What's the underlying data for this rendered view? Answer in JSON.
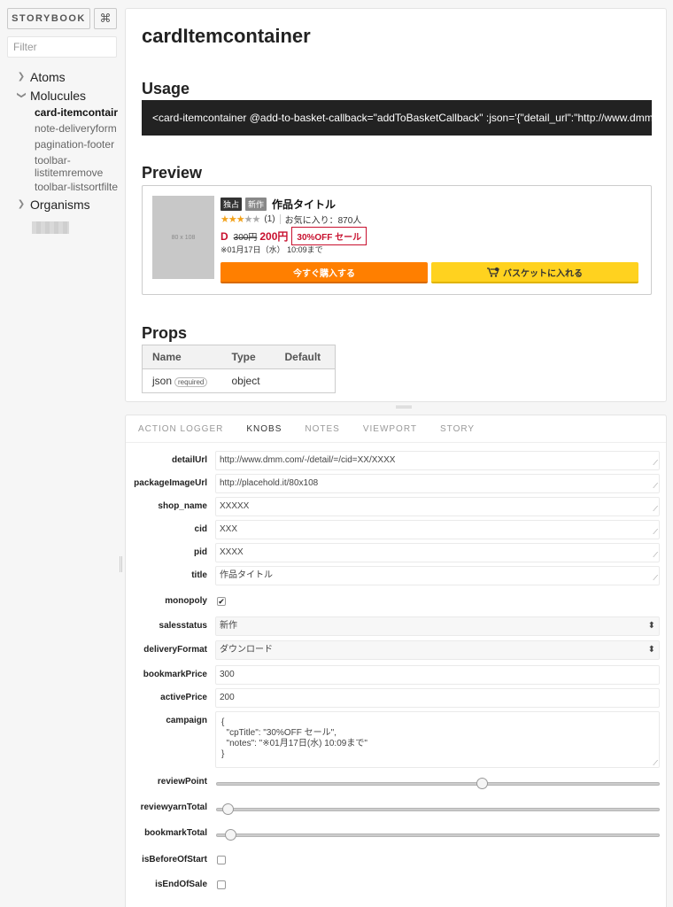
{
  "sidebar": {
    "brand": "STORYBOOK",
    "shortcut_glyph": "⌘",
    "filter_placeholder": "Filter",
    "tree": [
      {
        "label": "Atoms",
        "expanded": false
      },
      {
        "label": "Molucules",
        "expanded": true,
        "children": [
          "card-itemcontainer",
          "note-deliveryformat",
          "pagination-footer",
          "toolbar-listitemremove",
          "toolbar-listsortfilter"
        ]
      },
      {
        "label": "Organisms",
        "expanded": false
      }
    ],
    "selected": "card-itemcontainer",
    "tree_children_display": [
      "card-itemcontair",
      "note-deliveryform",
      "pagination-footer",
      "toolbar-\nlistitemremove",
      "toolbar-listsortfilte"
    ]
  },
  "preview": {
    "title": "cardItemcontainer",
    "usage_heading": "Usage",
    "usage_code": "<card-itemcontainer @add-to-basket-callback=\"addToBasketCallback\" :json='{\"detail_url\":\"http://www.dmm.com",
    "preview_heading": "Preview",
    "props_heading": "Props",
    "card": {
      "thumb_text": "80 x 108",
      "badge_monopoly": "独占",
      "badge_status": "新作",
      "title": "作品タイトル",
      "review_count": "(1)",
      "bookmark_text": "お気に入り：870人",
      "currency_glyph": "D",
      "old_price": "300円",
      "new_price": "200円",
      "campaign": "30%OFF セール",
      "notes": "※01月17日（水） 10:09まで",
      "buy_label": "今すぐ購入する",
      "basket_label": "バスケットに入れる",
      "stars_filled": 3,
      "stars_total": 5
    },
    "props_table": {
      "headers": [
        "Name",
        "Type",
        "Default"
      ],
      "rows": [
        {
          "name": "json",
          "required": "required",
          "type": "object",
          "default": ""
        }
      ]
    }
  },
  "addons": {
    "tabs": [
      "ACTION LOGGER",
      "KNOBS",
      "NOTES",
      "VIEWPORT",
      "STORY"
    ],
    "active_tab": "KNOBS",
    "knobs": {
      "detailUrl": {
        "label": "detailUrl",
        "value": "http://www.dmm.com/-/detail/=/cid=XX/XXXX"
      },
      "packageImageUrl": {
        "label": "packageImageUrl",
        "value": "http://placehold.it/80x108"
      },
      "shop_name": {
        "label": "shop_name",
        "value": "XXXXX"
      },
      "cid": {
        "label": "cid",
        "value": "XXX"
      },
      "pid": {
        "label": "pid",
        "value": "XXXX"
      },
      "title": {
        "label": "title",
        "value": "作品タイトル"
      },
      "monopoly": {
        "label": "monopoly",
        "checked": true
      },
      "salesstatus": {
        "label": "salesstatus",
        "value": "新作"
      },
      "deliveryFormat": {
        "label": "deliveryFormat",
        "value": "ダウンロード"
      },
      "bookmarkPrice": {
        "label": "bookmarkPrice",
        "value": "300"
      },
      "activePrice": {
        "label": "activePrice",
        "value": "200"
      },
      "campaign": {
        "label": "campaign",
        "value": "{\n  \"cpTitle\": \"30%OFF セール\",\n  \"notes\": \"※01月17日(水) 10:09まで\"\n}"
      },
      "reviewPoint": {
        "label": "reviewPoint",
        "fraction": 0.6
      },
      "reviewyarnTotal": {
        "label": "reviewyarnTotal",
        "fraction": 0.025
      },
      "bookmarkTotal": {
        "label": "bookmarkTotal",
        "fraction": 0.03
      },
      "isBeforeOfStart": {
        "label": "isBeforeOfStart",
        "checked": false
      },
      "isEndOfSale": {
        "label": "isEndOfSale",
        "checked": false
      }
    }
  },
  "colors": {
    "buy_button": "#ff7f00",
    "basket_button": "#ffd21f",
    "sale_red": "#c8102e",
    "star": "#f2a21c",
    "code_bg": "#222222"
  }
}
